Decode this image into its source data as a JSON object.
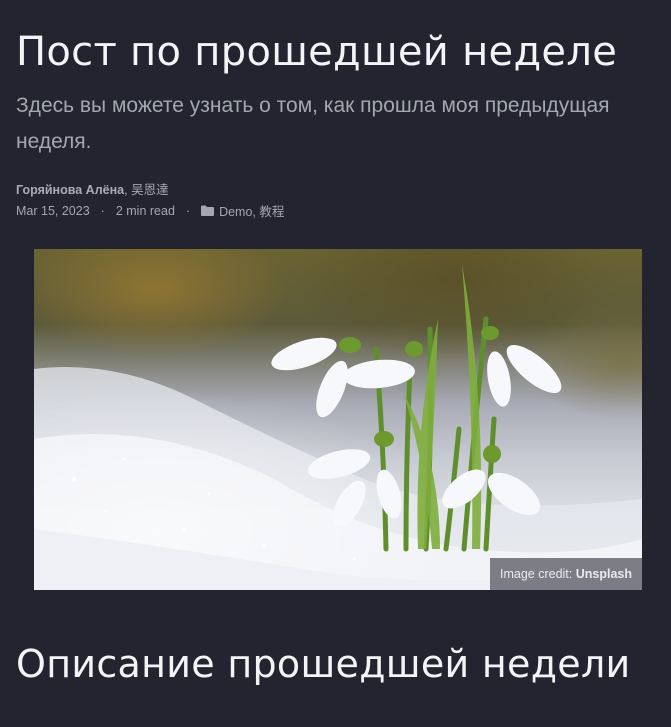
{
  "post": {
    "title": "Пост по прошедшей неделе",
    "subtitle": "Здесь вы можете узнать о том, как прошла моя предыдущая неделя.",
    "authors": {
      "primary": "Горяйнова Алёна",
      "separator": ", ",
      "secondary": "吴恩達"
    },
    "meta": {
      "date": "Mar 15, 2023",
      "dot": "·",
      "read_time": "2 min read",
      "category_icon": "folder-icon",
      "categories": "Demo, 教程"
    },
    "image": {
      "credit_prefix": "Image credit: ",
      "credit_source": "Unsplash"
    },
    "section_heading": "Описание прошедшей недели"
  }
}
